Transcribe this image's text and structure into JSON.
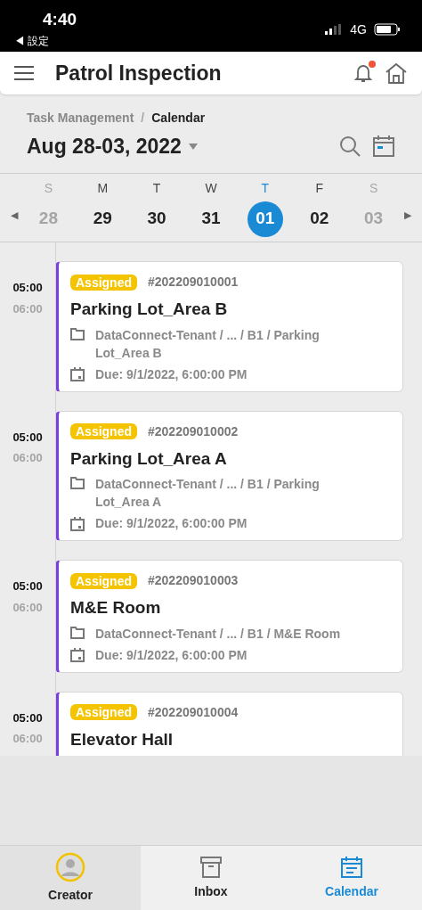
{
  "status_bar": {
    "time": "4:40",
    "back": "◀ 設定",
    "network": "4G"
  },
  "header": {
    "title": "Patrol Inspection",
    "notification_dot": true
  },
  "breadcrumb": [
    "Task Management",
    "Calendar"
  ],
  "breadcrumb_separator": "/",
  "date_range": "Aug 28-03, 2022",
  "week": {
    "prev": "◀",
    "next": "▶",
    "days": [
      {
        "letter": "S",
        "date": "28",
        "weekend": true,
        "selected": false
      },
      {
        "letter": "M",
        "date": "29",
        "weekend": false,
        "selected": false
      },
      {
        "letter": "T",
        "date": "30",
        "weekend": false,
        "selected": false
      },
      {
        "letter": "W",
        "date": "31",
        "weekend": false,
        "selected": false
      },
      {
        "letter": "T",
        "date": "01",
        "weekend": false,
        "selected": true
      },
      {
        "letter": "F",
        "date": "02",
        "weekend": false,
        "selected": false
      },
      {
        "letter": "S",
        "date": "03",
        "weekend": true,
        "selected": false
      }
    ]
  },
  "tasks": [
    {
      "start": "05:00",
      "end": "06:00",
      "status": "Assigned",
      "number": "#202209010001",
      "title": "Parking Lot_Area B",
      "path": "DataConnect-Tenant / ... / B1 / Parking Lot_Area B",
      "due": "Due: 9/1/2022, 6:00:00 PM"
    },
    {
      "start": "05:00",
      "end": "06:00",
      "status": "Assigned",
      "number": "#202209010002",
      "title": "Parking Lot_Area A",
      "path": "DataConnect-Tenant / ... / B1 / Parking Lot_Area A",
      "due": "Due: 9/1/2022, 6:00:00 PM"
    },
    {
      "start": "05:00",
      "end": "06:00",
      "status": "Assigned",
      "number": "#202209010003",
      "title": "M&E Room",
      "path": "DataConnect-Tenant / ... / B1 / M&E Room",
      "due": "Due: 9/1/2022, 6:00:00 PM"
    },
    {
      "start": "05:00",
      "end": "06:00",
      "status": "Assigned",
      "number": "#202209010004",
      "title": "Elevator Hall"
    }
  ],
  "tab_bar": [
    {
      "label": "Creator",
      "kind": "avatar",
      "selected": false
    },
    {
      "label": "Inbox",
      "kind": "inbox",
      "selected": false
    },
    {
      "label": "Calendar",
      "kind": "calendar",
      "selected": true
    }
  ]
}
